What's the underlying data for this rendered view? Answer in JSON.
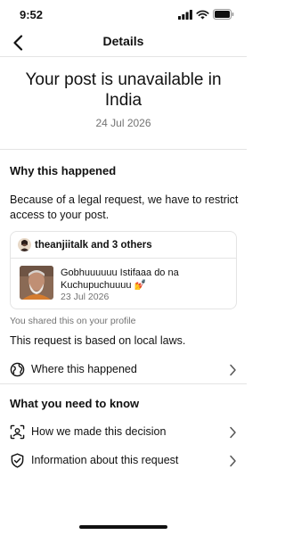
{
  "status_bar": {
    "time": "9:52",
    "icons": [
      "signal-icon",
      "wifi-icon",
      "battery-icon"
    ]
  },
  "nav": {
    "title": "Details",
    "back_icon": "chevron-left-icon"
  },
  "header": {
    "headline": "Your post is unavailable in India",
    "date": "24 Jul 2026"
  },
  "why": {
    "heading": "Why this happened",
    "body": "Because of a legal request, we have to restrict access to your post.",
    "post_card": {
      "users": "theanjiitalk and 3 others",
      "caption": "Gobhuuuuuu Istifaaa do na Kuchupuchuuuu 💅",
      "date": "23 Jul 2026"
    },
    "shared_note": "You shared this on your profile",
    "basis": "This request is based on local laws.",
    "where_row": {
      "label": "Where this happened",
      "icon": "globe-icon"
    }
  },
  "need_to_know": {
    "heading": "What you need to know",
    "rows": [
      {
        "label": "How we made this decision",
        "icon": "scan-face-icon"
      },
      {
        "label": "Information about this request",
        "icon": "shield-check-icon"
      }
    ]
  },
  "colors": {
    "text": "#111111",
    "secondary_text": "#737373",
    "divider": "#e4e4e4",
    "background": "#ffffff"
  }
}
